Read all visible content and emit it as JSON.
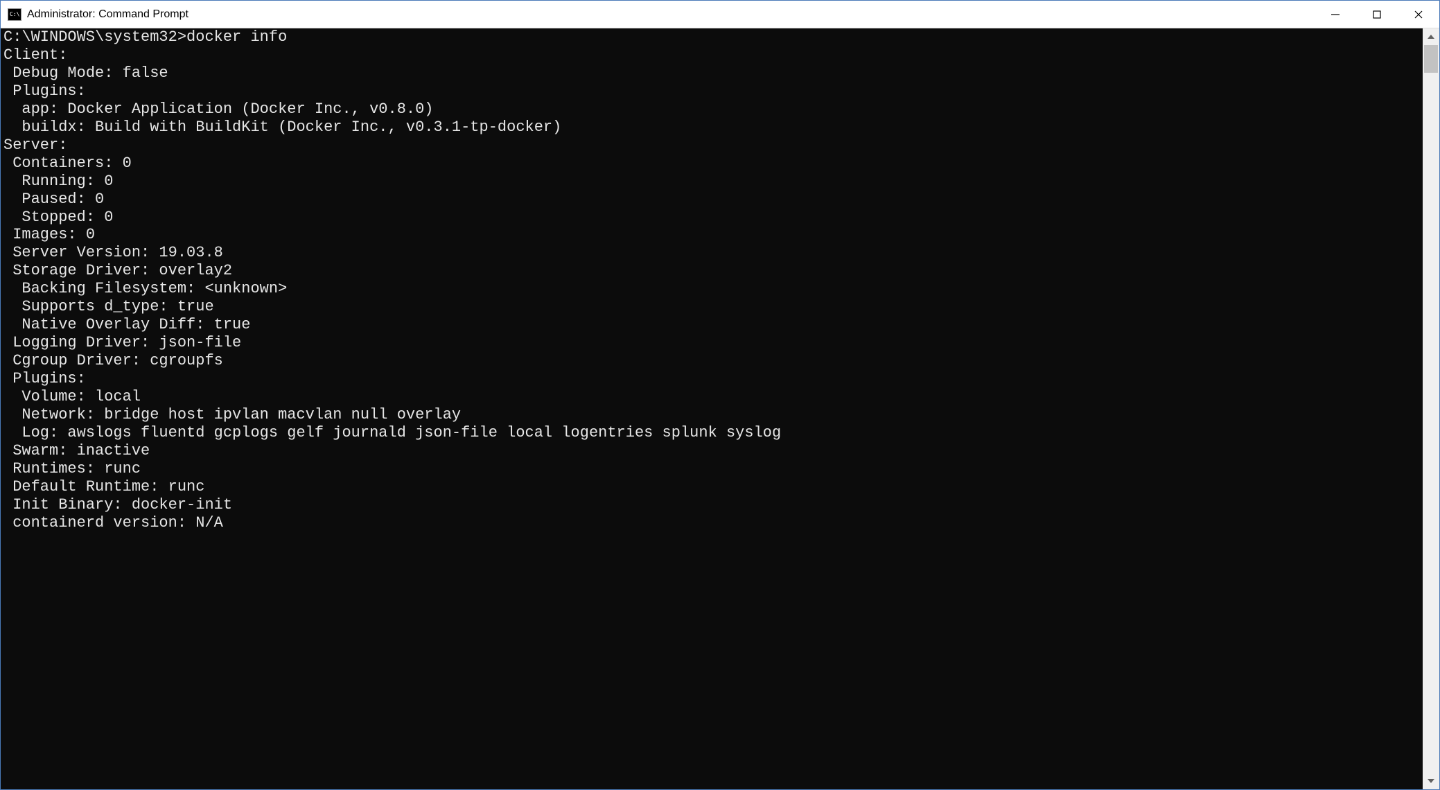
{
  "window": {
    "title": "Administrator: Command Prompt"
  },
  "terminal": {
    "prompt": "C:\\WINDOWS\\system32>",
    "command": "docker info",
    "lines": [
      "Client:",
      " Debug Mode: false",
      " Plugins:",
      "  app: Docker Application (Docker Inc., v0.8.0)",
      "  buildx: Build with BuildKit (Docker Inc., v0.3.1-tp-docker)",
      "",
      "Server:",
      " Containers: 0",
      "  Running: 0",
      "  Paused: 0",
      "  Stopped: 0",
      " Images: 0",
      " Server Version: 19.03.8",
      " Storage Driver: overlay2",
      "  Backing Filesystem: <unknown>",
      "  Supports d_type: true",
      "  Native Overlay Diff: true",
      " Logging Driver: json-file",
      " Cgroup Driver: cgroupfs",
      " Plugins:",
      "  Volume: local",
      "  Network: bridge host ipvlan macvlan null overlay",
      "  Log: awslogs fluentd gcplogs gelf journald json-file local logentries splunk syslog",
      " Swarm: inactive",
      " Runtimes: runc",
      " Default Runtime: runc",
      " Init Binary: docker-init",
      " containerd version: N/A"
    ]
  }
}
